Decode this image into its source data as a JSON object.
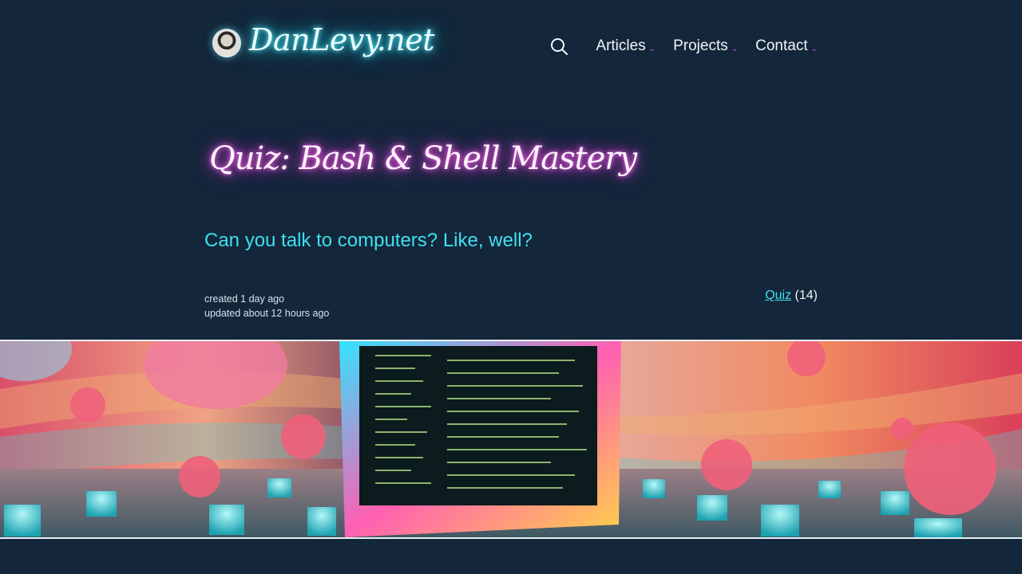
{
  "header": {
    "site_name": "DanLevy.net",
    "nav": [
      {
        "label": "Articles"
      },
      {
        "label": "Projects"
      },
      {
        "label": "Contact"
      }
    ]
  },
  "icons": {
    "search": "search-icon",
    "dropdown": "chevron-down-icon"
  },
  "post": {
    "title": "Quiz: Bash & Shell Mastery",
    "subtitle": "Can you talk to computers? Like, well?",
    "created": "created 1 day ago",
    "updated": "updated about 12 hours ago",
    "tag": {
      "label": "Quiz",
      "count": "(14)"
    }
  },
  "colors": {
    "background": "#13263a",
    "logo_glow": "#2ad1e6",
    "title_glow": "#e040d6",
    "accent_cyan": "#3ee0ee",
    "chevron_magenta": "#d14fd8"
  }
}
